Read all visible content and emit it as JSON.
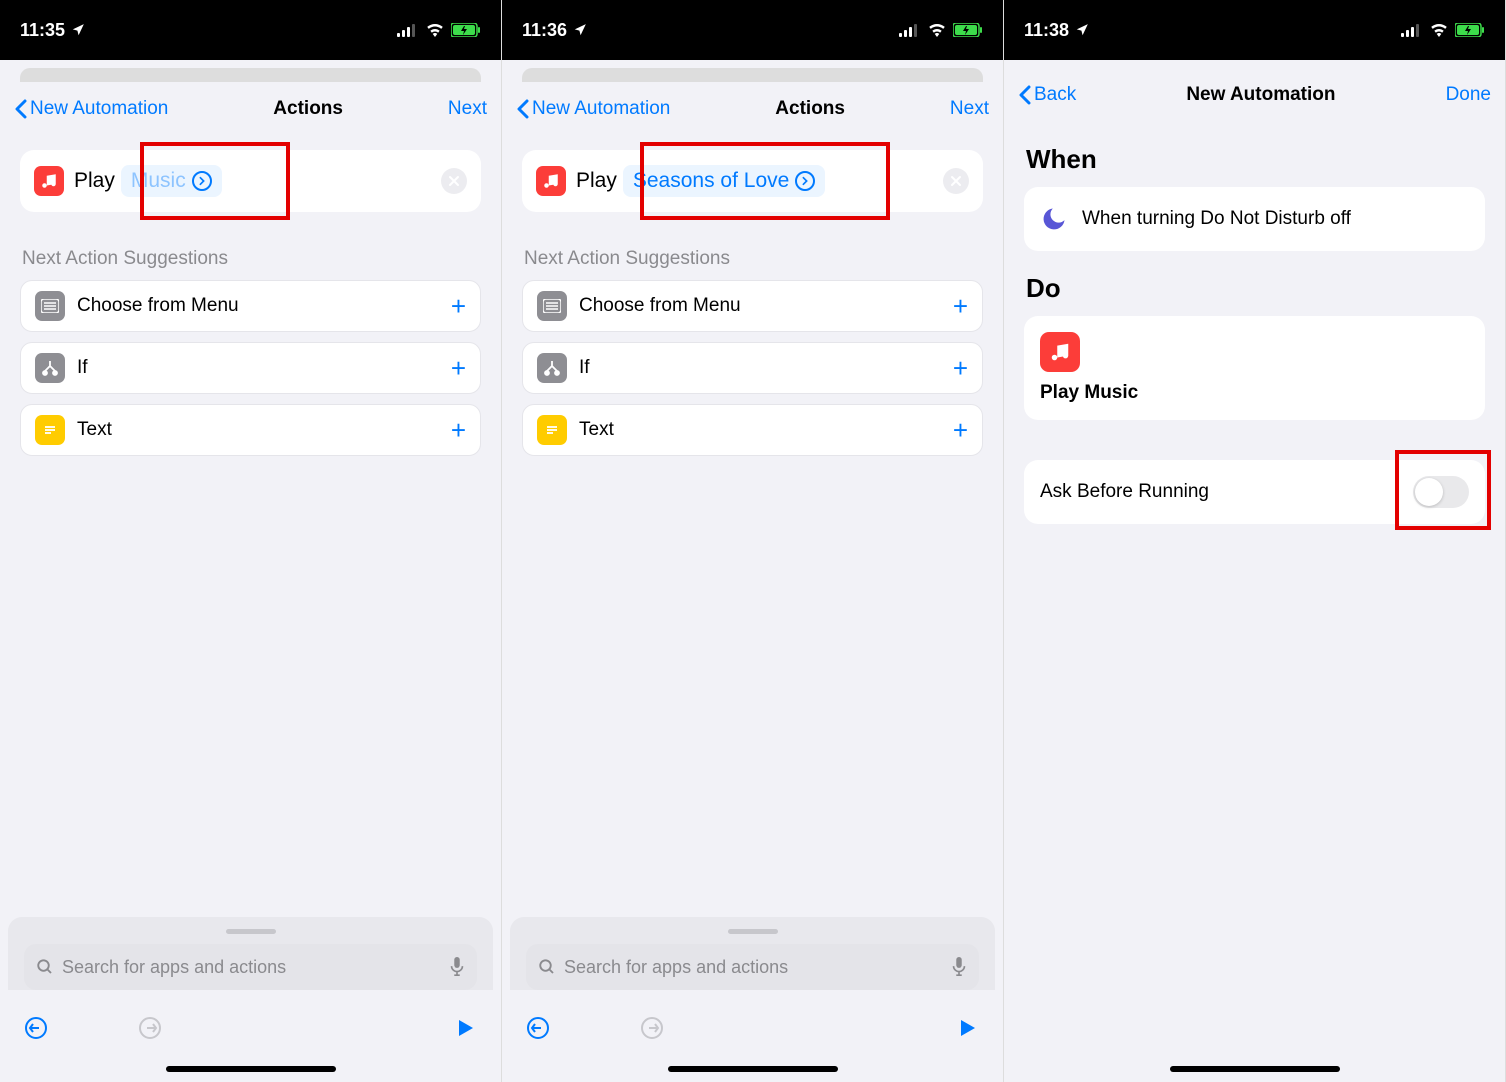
{
  "phone1": {
    "time": "11:35",
    "back_label": "New Automation",
    "title": "Actions",
    "next_label": "Next",
    "play_label": "Play",
    "token_text": "Music",
    "suggestions_label": "Next Action Suggestions",
    "suggestions": [
      "Choose from Menu",
      "If",
      "Text"
    ],
    "search_placeholder": "Search for apps and actions"
  },
  "phone2": {
    "time": "11:36",
    "back_label": "New Automation",
    "title": "Actions",
    "next_label": "Next",
    "play_label": "Play",
    "token_text": "Seasons of Love",
    "suggestions_label": "Next Action Suggestions",
    "suggestions": [
      "Choose from Menu",
      "If",
      "Text"
    ],
    "search_placeholder": "Search for apps and actions"
  },
  "phone3": {
    "time": "11:38",
    "back_label": "Back",
    "title": "New Automation",
    "done_label": "Done",
    "when_header": "When",
    "when_text": "When turning Do Not Disturb off",
    "do_header": "Do",
    "do_label": "Play Music",
    "toggle_label": "Ask Before Running"
  }
}
